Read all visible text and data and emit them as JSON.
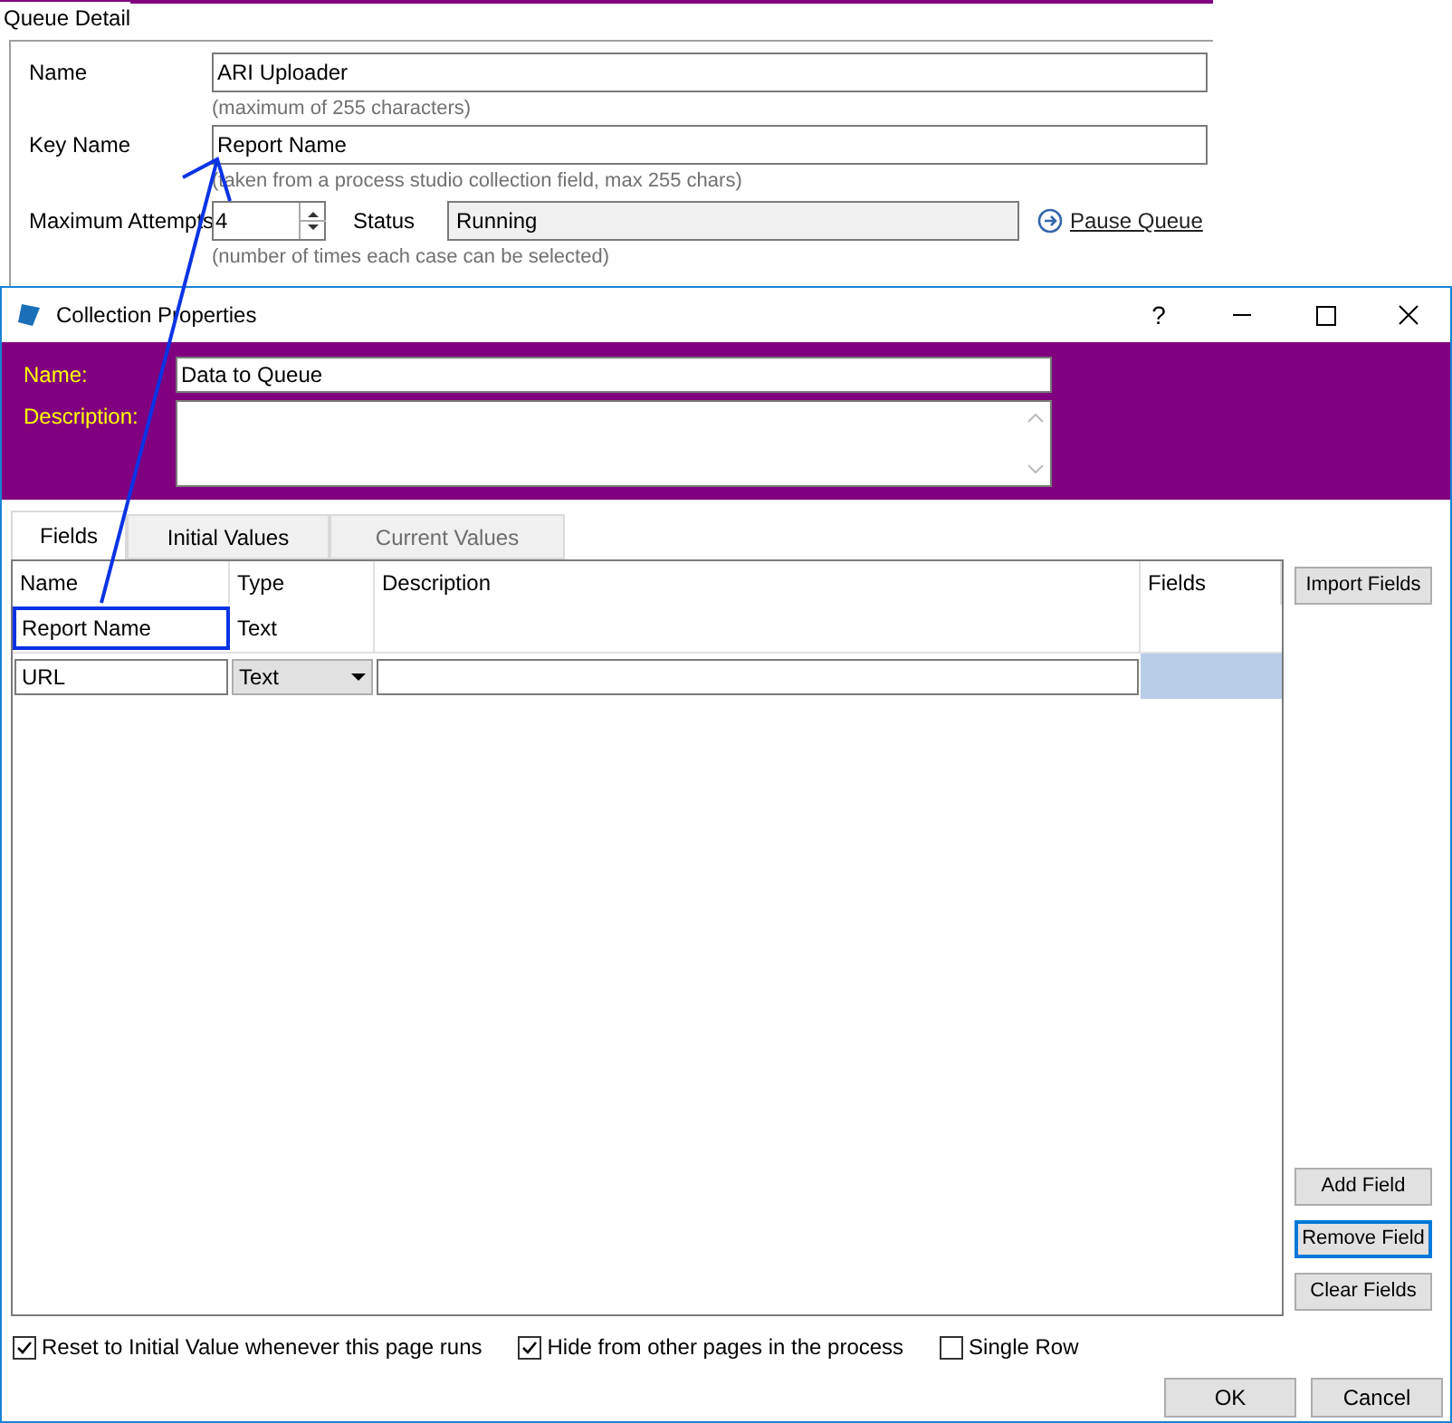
{
  "queue_detail": {
    "title": "Queue Detail",
    "fields": [
      {
        "label": "Name",
        "value": "ARI Uploader",
        "hint": "(maximum of 255 characters)"
      },
      {
        "label": "Key Name",
        "value": "Report Name",
        "hint": "(taken from a process studio collection field, max 255 chars)"
      }
    ],
    "max_attempts": {
      "label": "Maximum Attempts",
      "value": "4",
      "hint": "(number of times each case can be selected)"
    },
    "status": {
      "label": "Status",
      "value": "Running"
    },
    "pause_link": "Pause Queue"
  },
  "dialog": {
    "title": "Collection Properties",
    "title_buttons": [
      "?"
    ],
    "name": {
      "label": "Name:",
      "value": "Data to Queue"
    },
    "description": {
      "label": "Description:"
    },
    "tabs": [
      {
        "label": "Fields",
        "selected": true,
        "disabled": false
      },
      {
        "label": "Initial Values",
        "selected": false,
        "disabled": false
      },
      {
        "label": "Current Values",
        "selected": false,
        "disabled": true
      }
    ],
    "table": {
      "columns": [
        "Name",
        "Type",
        "Description",
        "Fields"
      ],
      "rows": [
        {
          "kind": "view",
          "name": "Report Name",
          "type": "Text"
        },
        {
          "kind": "edit",
          "name": "URL",
          "type": "Text"
        }
      ]
    },
    "side_buttons": [
      {
        "label": "Import Fields",
        "focused": false
      }
    ],
    "bottom_side_buttons": [
      {
        "label": "Add Field",
        "focused": false
      },
      {
        "label": "Remove Field",
        "focused": true
      },
      {
        "label": "Clear Fields",
        "focused": false
      }
    ],
    "checkboxes": [
      {
        "label": "Reset to Initial Value whenever this page runs",
        "checked": true
      },
      {
        "label": "Hide from other pages in the process",
        "checked": true
      },
      {
        "label": "Single Row",
        "checked": false
      }
    ],
    "buttons": [
      "OK",
      "Cancel"
    ]
  }
}
